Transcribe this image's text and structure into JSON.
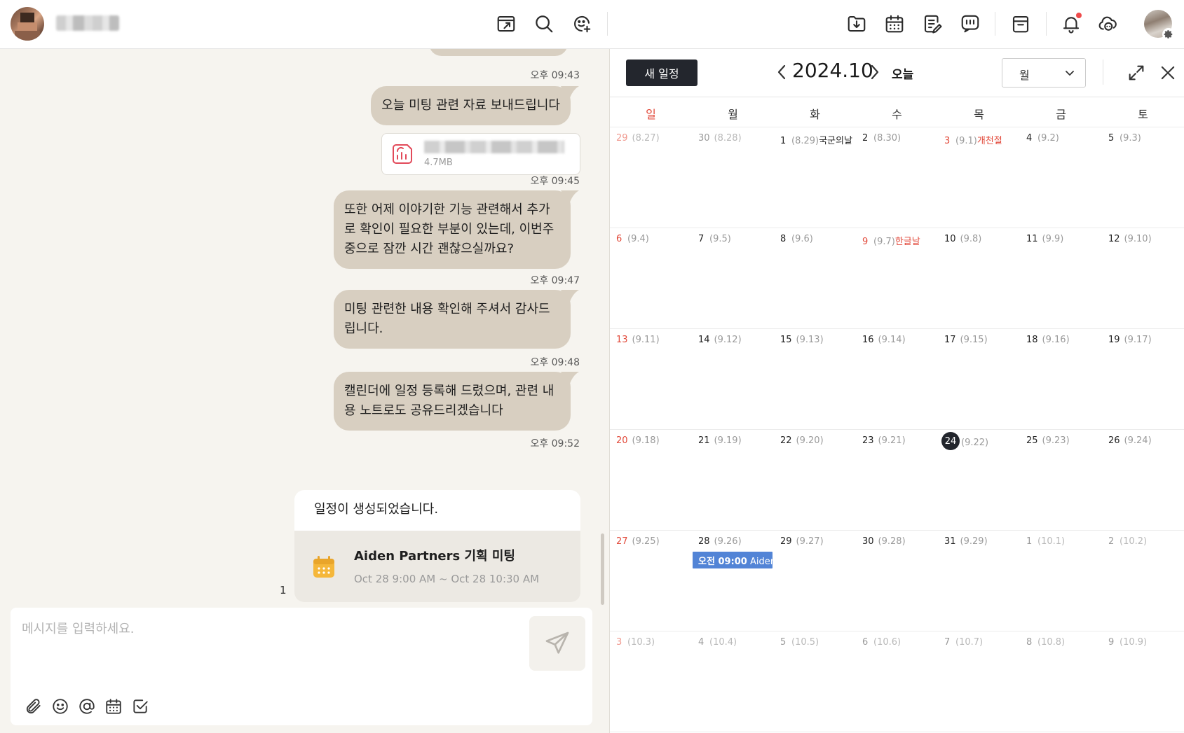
{
  "chat": {
    "messages": [
      {
        "time": "오후 09:43",
        "text": "오늘 미팅 관련 자료 보내드립니다"
      },
      {
        "file_size": "4.7MB"
      },
      {
        "time": "오후 09:45",
        "text": "또한 어제 이야기한 기능 관련해서 추가\n로 확인이 필요한 부분이 있는데, 이번주\n중으로 잠깐 시간 괜찮으실까요?"
      },
      {
        "time": "오후 09:47",
        "text": "미팅 관련한 내용 확인해 주셔서 감사드\n립니다."
      },
      {
        "time": "오후 09:48",
        "text": "캘린더에 일정 등록해 드렸으며, 관련 내\n용 노트로도 공유드리겠습니다"
      },
      {
        "time": "오후 09:52"
      }
    ],
    "event_card": {
      "header": "일정이 생성되었습니다.",
      "title": "Aiden Partners 기획 미팅",
      "time": "Oct 28 9:00 AM ~ Oct 28 10:30 AM"
    },
    "unread_count": "1",
    "composer": {
      "placeholder": "메시지를 입력하세요."
    }
  },
  "calendar": {
    "new_event_label": "새 일정",
    "month_title": "2024.10",
    "today_label": "오늘",
    "view_mode": "월",
    "weekdays": [
      "일",
      "월",
      "화",
      "수",
      "목",
      "금",
      "토"
    ],
    "weeks": [
      [
        {
          "d": "29",
          "l": "(8.27)",
          "other": true
        },
        {
          "d": "30",
          "l": "(8.28)",
          "other": true
        },
        {
          "d": "1",
          "l": "(8.29)",
          "holiday": "국군의날",
          "holiday_black": true
        },
        {
          "d": "2",
          "l": "(8.30)"
        },
        {
          "d": "3",
          "l": "(9.1)",
          "holiday": "개천절",
          "red": true
        },
        {
          "d": "4",
          "l": "(9.2)"
        },
        {
          "d": "5",
          "l": "(9.3)"
        }
      ],
      [
        {
          "d": "6",
          "l": "(9.4)"
        },
        {
          "d": "7",
          "l": "(9.5)"
        },
        {
          "d": "8",
          "l": "(9.6)"
        },
        {
          "d": "9",
          "l": "(9.7)",
          "holiday": "한글날",
          "red": true
        },
        {
          "d": "10",
          "l": "(9.8)"
        },
        {
          "d": "11",
          "l": "(9.9)"
        },
        {
          "d": "12",
          "l": "(9.10)"
        }
      ],
      [
        {
          "d": "13",
          "l": "(9.11)"
        },
        {
          "d": "14",
          "l": "(9.12)"
        },
        {
          "d": "15",
          "l": "(9.13)"
        },
        {
          "d": "16",
          "l": "(9.14)"
        },
        {
          "d": "17",
          "l": "(9.15)"
        },
        {
          "d": "18",
          "l": "(9.16)"
        },
        {
          "d": "19",
          "l": "(9.17)"
        }
      ],
      [
        {
          "d": "20",
          "l": "(9.18)"
        },
        {
          "d": "21",
          "l": "(9.19)"
        },
        {
          "d": "22",
          "l": "(9.20)"
        },
        {
          "d": "23",
          "l": "(9.21)"
        },
        {
          "d": "24",
          "l": "(9.22)",
          "today": true
        },
        {
          "d": "25",
          "l": "(9.23)"
        },
        {
          "d": "26",
          "l": "(9.24)"
        }
      ],
      [
        {
          "d": "27",
          "l": "(9.25)"
        },
        {
          "d": "28",
          "l": "(9.26)"
        },
        {
          "d": "29",
          "l": "(9.27)"
        },
        {
          "d": "30",
          "l": "(9.28)"
        },
        {
          "d": "31",
          "l": "(9.29)"
        },
        {
          "d": "1",
          "l": "(10.1)",
          "other": true
        },
        {
          "d": "2",
          "l": "(10.2)",
          "other": true
        }
      ],
      [
        {
          "d": "3",
          "l": "(10.3)",
          "other": true
        },
        {
          "d": "4",
          "l": "(10.4)",
          "other": true
        },
        {
          "d": "5",
          "l": "(10.5)",
          "other": true
        },
        {
          "d": "6",
          "l": "(10.6)",
          "other": true
        },
        {
          "d": "7",
          "l": "(10.7)",
          "other": true
        },
        {
          "d": "8",
          "l": "(10.8)",
          "other": true
        },
        {
          "d": "9",
          "l": "(10.9)",
          "other": true
        }
      ]
    ],
    "event_chip": {
      "time": "오전 09:00",
      "title": "Aiden Partners 기획 미팅"
    }
  },
  "colors": {
    "bubble": "#d8cfc1",
    "chat_bg": "#f6f4ef",
    "primary_dark": "#23262d",
    "holiday_red": "#e24a3b",
    "event_blue": "#5284d6"
  }
}
